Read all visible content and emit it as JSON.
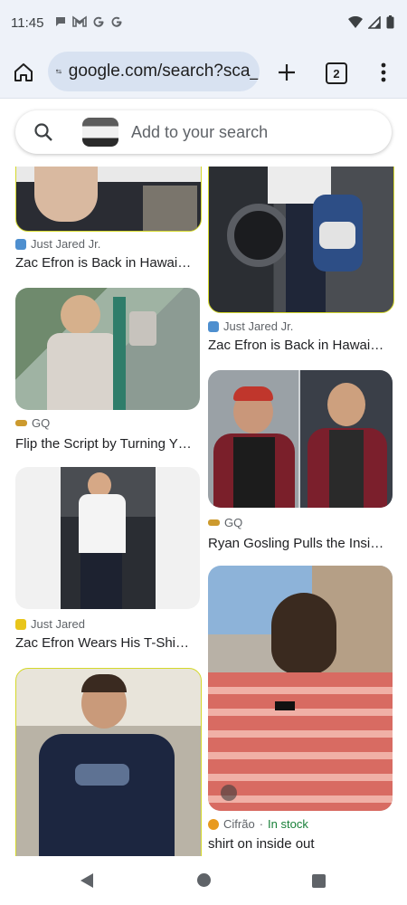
{
  "status_bar": {
    "time": "11:45",
    "notification_icons": [
      "chat-icon",
      "gmail-icon",
      "google-icon",
      "google-icon"
    ],
    "system_icons": [
      "wifi-icon",
      "signal-icon",
      "battery-icon"
    ]
  },
  "browser": {
    "url": "google.com/search?sca_",
    "tab_count": "2"
  },
  "search": {
    "placeholder": "Add to your search"
  },
  "results": [
    {
      "source": "Just Jared Jr.",
      "title": "Zac Efron is Back in Hawai…",
      "favicon_color": "#4e8fcf"
    },
    {
      "source": "Just Jared Jr.",
      "title": "Zac Efron is Back in Hawai…",
      "favicon_color": "#4e8fcf"
    },
    {
      "source": "GQ",
      "title": "Flip the Script by Turning Y…",
      "favicon_color": "#cc9a2e"
    },
    {
      "source": "GQ",
      "title": "Ryan Gosling Pulls the Insi…",
      "favicon_color": "#cc9a2e"
    },
    {
      "source": "Just Jared",
      "title": "Zac Efron Wears His T-Shir…",
      "favicon_color": "#e8c51a"
    },
    {
      "source": "Cifrão",
      "stock": "In stock",
      "title": "shirt on inside out",
      "favicon_color": "#e89a1e"
    }
  ],
  "colors": {
    "chrome_bg": "#eef2f9",
    "url_bg": "#d8e2f1",
    "in_stock": "#188038"
  }
}
